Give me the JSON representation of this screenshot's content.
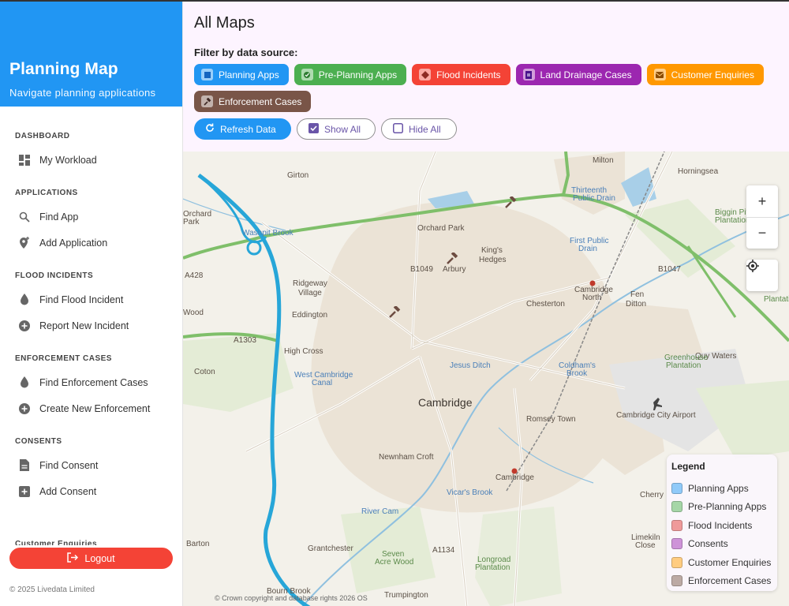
{
  "sidebar": {
    "title": "Planning Map",
    "subtitle": "Navigate planning applications",
    "sections": [
      {
        "heading": "Dashboard",
        "items": [
          {
            "label": "My Workload",
            "icon": "dashboard-icon"
          }
        ]
      },
      {
        "heading": "Applications",
        "items": [
          {
            "label": "Find App",
            "icon": "search-icon"
          },
          {
            "label": "Add Application",
            "icon": "add-location-icon"
          }
        ]
      },
      {
        "heading": "Flood Incidents",
        "items": [
          {
            "label": "Find Flood Incident",
            "icon": "water-drop-icon"
          },
          {
            "label": "Report New Incident",
            "icon": "add-circle-icon"
          }
        ]
      },
      {
        "heading": "Enforcement Cases",
        "items": [
          {
            "label": "Find Enforcement Cases",
            "icon": "water-drop-icon"
          },
          {
            "label": "Create New Enforcement",
            "icon": "add-circle-icon"
          }
        ]
      },
      {
        "heading": "Consents",
        "items": [
          {
            "label": "Find Consent",
            "icon": "document-icon"
          },
          {
            "label": "Add Consent",
            "icon": "add-box-icon"
          }
        ]
      }
    ],
    "cut_section": "Customer Enquiries",
    "logout_label": "Logout",
    "copyright": "© 2025 Livedata Limited"
  },
  "main": {
    "title": "All Maps",
    "filter_label": "Filter by data source:",
    "chips": [
      {
        "label": "Planning Apps",
        "color": "#2196f3"
      },
      {
        "label": "Pre-Planning Apps",
        "color": "#4caf50"
      },
      {
        "label": "Flood Incidents",
        "color": "#f44336"
      },
      {
        "label": "Land Drainage Cases",
        "color": "#9c27b0"
      },
      {
        "label": "Customer Enquiries",
        "color": "#ff9800"
      },
      {
        "label": "Enforcement Cases",
        "color": "#795548"
      }
    ],
    "refresh_label": "Refresh Data",
    "show_all_label": "Show All",
    "hide_all_label": "Hide All"
  },
  "map": {
    "labels": {
      "girton": "Girton",
      "milton": "Milton",
      "horningsea": "Horningsea",
      "orchard": "Orchard",
      "park_l": "Park",
      "washpit": "Washpit Brook",
      "orchard_park": "Orchard Park",
      "thirteenth": "Thirteenth",
      "public_drain": "Public Drain",
      "biggin": "Biggin Pit",
      "plantation": "Plantation",
      "kings": "King's",
      "hedges": "Hedges",
      "arbury": "Arbury",
      "first_public": "First Public",
      "drain": "Drain",
      "ridgeway": "Ridgeway",
      "village": "Village",
      "eddington": "Eddington",
      "chesterton": "Chesterton",
      "cambridge_north": "Cambridge",
      "north": "North",
      "fen": "Fen",
      "ditton": "Ditton",
      "wood": "Wood",
      "high_cross": "High Cross",
      "quy_waters": "Quy Waters",
      "greenhouse": "Greenhouse",
      "plantation2": "Plantation",
      "coton": "Coton",
      "west_cambridge": "West Cambridge",
      "canal": "Canal",
      "jesus_ditch": "Jesus Ditch",
      "coldhams": "Coldham's",
      "brook": "Brook",
      "cambridge": "Cambridge",
      "airport": "Cambridge City Airport",
      "romsey": "Romsey Town",
      "newnham": "Newnham Croft",
      "cambridge_station": "Cambridge",
      "vicars": "Vicar's Brook",
      "cherry": "Cherry",
      "river_cam": "River Cam",
      "barton": "Barton",
      "grantchester": "Grantchester",
      "seven": "Seven",
      "acre_wood": "Acre Wood",
      "longroad": "Longroad",
      "plantation3": "Plantation",
      "limekiln": "Limekiln",
      "close": "Close",
      "bourn": "Bourn Brook",
      "trumpington": "Trumpington",
      "a1303": "A1303",
      "a428": "A428",
      "b1049": "B1049",
      "a1134": "A1134",
      "b1047": "B1047",
      "plantation_r": "Plantatio"
    },
    "zoom_in": "+",
    "zoom_out": "−",
    "attribution": "© Crown copyright and database rights 2026 OS"
  },
  "legend": {
    "title": "Legend",
    "items": [
      {
        "label": "Planning Apps",
        "color": "#90caf9"
      },
      {
        "label": "Pre-Planning Apps",
        "color": "#a5d6a7"
      },
      {
        "label": "Flood Incidents",
        "color": "#ef9a9a"
      },
      {
        "label": "Consents",
        "color": "#ce93d8"
      },
      {
        "label": "Customer Enquiries",
        "color": "#ffcc80"
      },
      {
        "label": "Enforcement Cases",
        "color": "#bcaaa4"
      }
    ]
  }
}
